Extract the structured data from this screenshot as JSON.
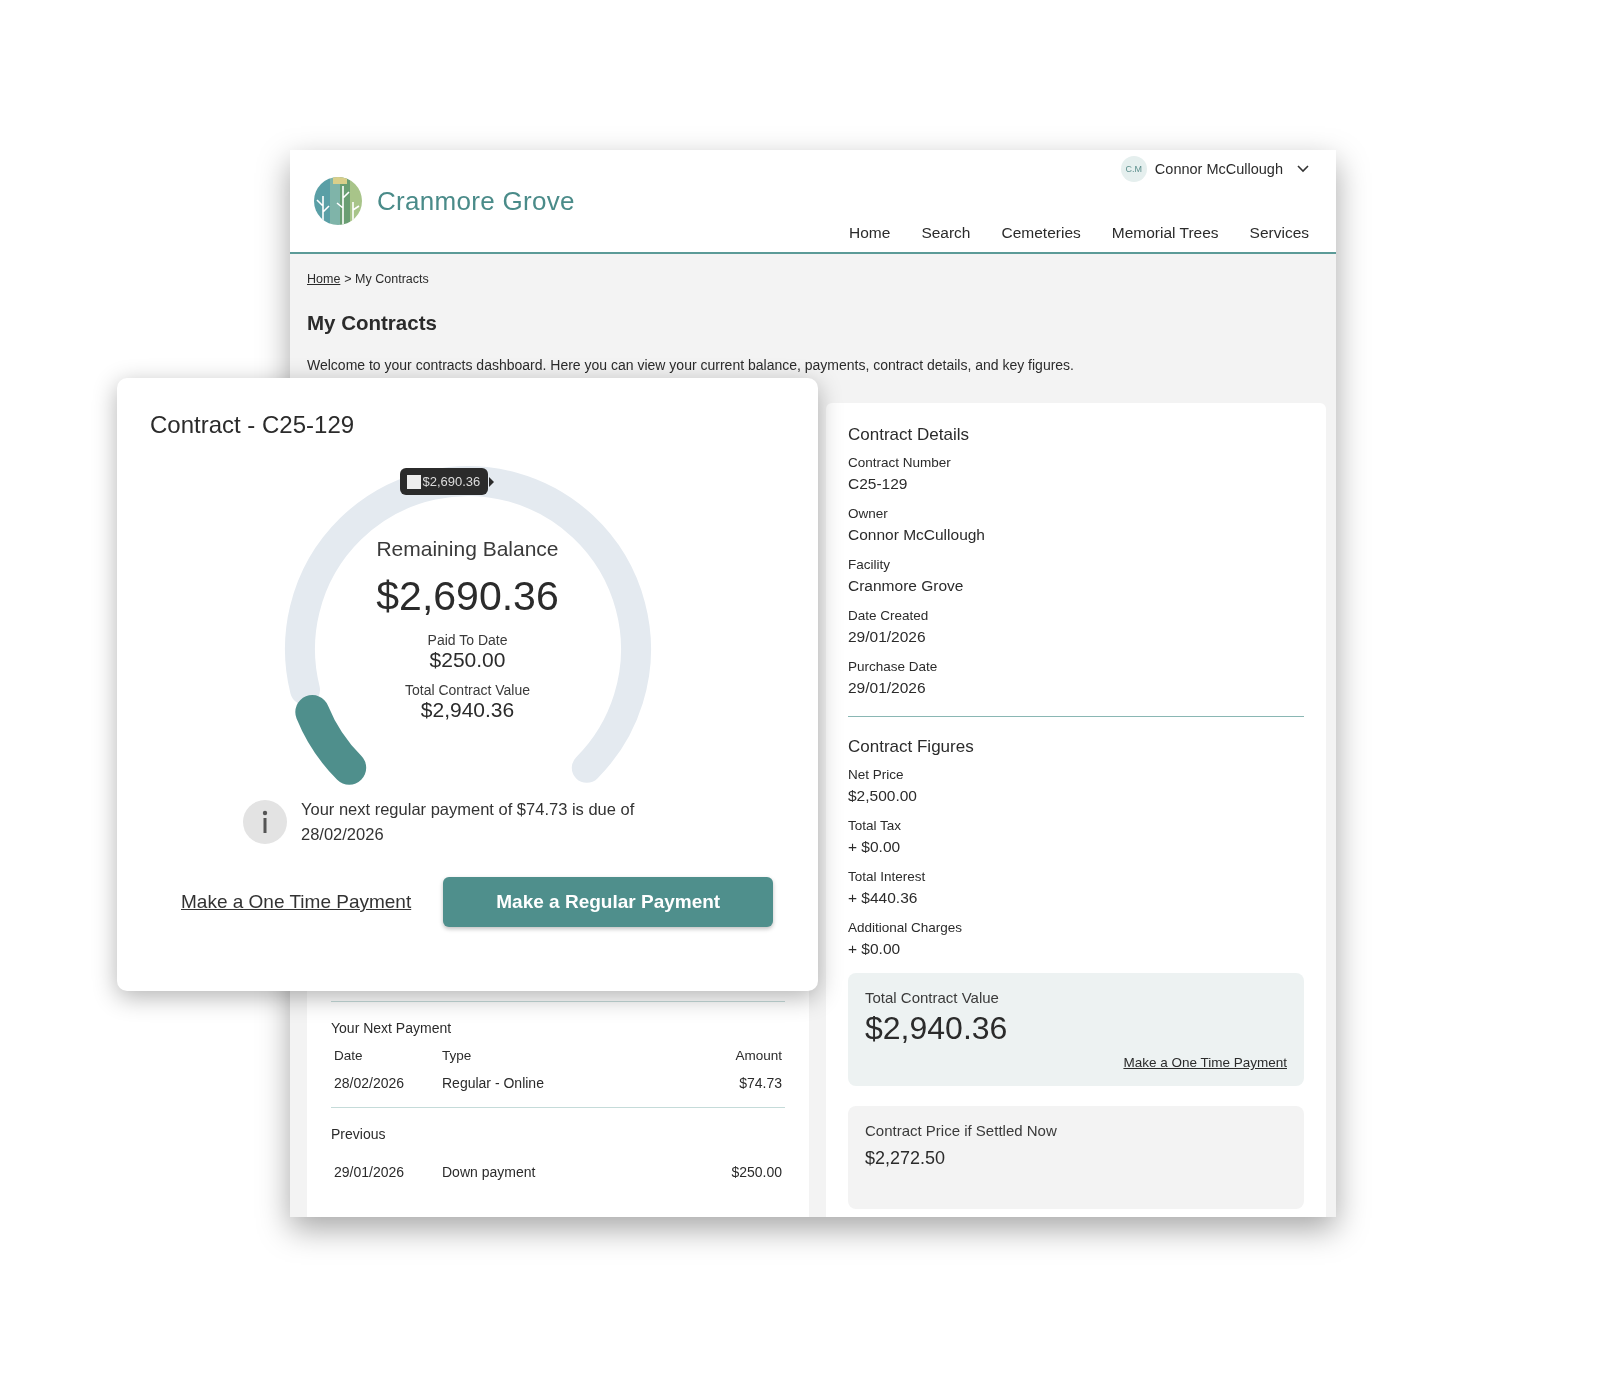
{
  "header": {
    "brand": "Cranmore Grove",
    "user": {
      "initials": "C.M",
      "name": "Connor McCullough"
    },
    "nav": [
      {
        "label": "Home"
      },
      {
        "label": "Search"
      },
      {
        "label": "Cemeteries"
      },
      {
        "label": "Memorial Trees"
      },
      {
        "label": "Services"
      }
    ]
  },
  "breadcrumb": {
    "link": "Home",
    "current": "> My Contracts"
  },
  "page": {
    "title": "My Contracts",
    "intro": "Welcome to your contracts dashboard. Here you can view your current balance, payments, contract details, and key figures."
  },
  "contract_card": {
    "title": "Contract - C25-129",
    "gauge": {
      "level": 0.085,
      "tooltip": "$2,690.36",
      "label": "Remaining Balance",
      "amount": "$2,690.36",
      "paid_label": "Paid To Date",
      "paid": "$250.00",
      "total_label": "Total Contract Value",
      "total": "$2,940.36"
    },
    "notice": "Your next regular payment of $74.73 is due of 28/02/2026",
    "actions": [
      {
        "label": "Make a One Time Payment",
        "kind": "link"
      },
      {
        "label": "Make a Regular Payment",
        "kind": "primary"
      }
    ]
  },
  "payments": {
    "next": {
      "title": "Your Next Payment",
      "columns": [
        "Date",
        "Type",
        "Amount"
      ],
      "rows": [
        [
          "28/02/2026",
          "Regular - Online",
          "$74.73"
        ]
      ]
    },
    "previous": {
      "title": "Previous",
      "rows": [
        [
          "29/01/2026",
          "Down payment",
          "$250.00"
        ]
      ]
    }
  },
  "details": {
    "title": "Contract Details",
    "fields": [
      {
        "label": "Contract Number",
        "value": "C25-129"
      },
      {
        "label": "Owner",
        "value": "Connor McCullough"
      },
      {
        "label": "Facility",
        "value": "Cranmore Grove"
      },
      {
        "label": "Date Created",
        "value": "29/01/2026"
      },
      {
        "label": "Purchase Date",
        "value": "29/01/2026"
      }
    ]
  },
  "figures": {
    "title": "Contract Figures",
    "fields": [
      {
        "label": "Net Price",
        "value": "$2,500.00"
      },
      {
        "label": "Total Tax",
        "value": "+ $0.00"
      },
      {
        "label": "Total Interest",
        "value": "+ $440.36"
      },
      {
        "label": "Additional Charges",
        "value": "+ $0.00"
      }
    ],
    "total": {
      "label": "Total Contract Value",
      "value": "$2,940.36",
      "link": "Make a One Time Payment"
    },
    "settle": {
      "label": "Contract Price if Settled Now",
      "value": "$2,272.50"
    }
  }
}
